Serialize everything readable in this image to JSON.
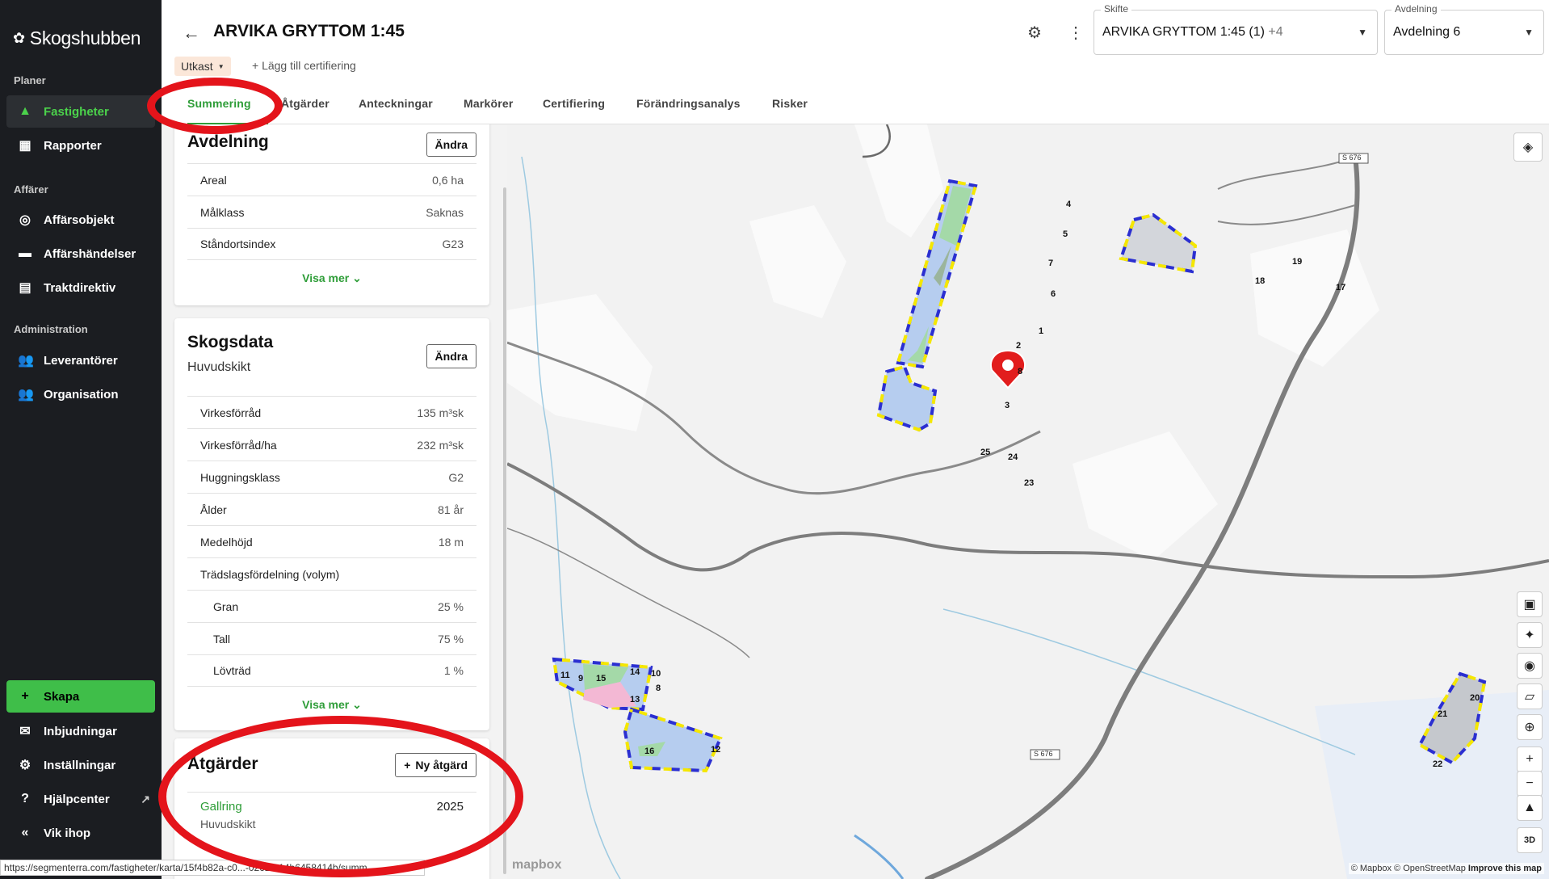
{
  "sidebar": {
    "logo": "Skogshubben",
    "sections": [
      {
        "label": "Planer"
      },
      {
        "label": "Affärer"
      },
      {
        "label": "Administration"
      }
    ],
    "items": [
      {
        "label": "Fastigheter",
        "icon": "tree-icon"
      },
      {
        "label": "Rapporter",
        "icon": "dashboard-icon"
      },
      {
        "label": "Affärsobjekt",
        "icon": "target-icon"
      },
      {
        "label": "Affärshändelser",
        "icon": "briefcase-icon"
      },
      {
        "label": "Traktdirektiv",
        "icon": "clipboard-icon"
      },
      {
        "label": "Leverantörer",
        "icon": "people-icon"
      },
      {
        "label": "Organisation",
        "icon": "people-icon"
      }
    ],
    "bottom": [
      {
        "label": "Skapa",
        "icon": "plus-icon"
      },
      {
        "label": "Inbjudningar",
        "icon": "mail-icon"
      },
      {
        "label": "Inställningar",
        "icon": "gear-icon"
      },
      {
        "label": "Hjälpcenter",
        "icon": "help-icon"
      },
      {
        "label": "Vik ihop",
        "icon": "collapse-icon"
      }
    ]
  },
  "header": {
    "title": "ARVIKA GRYTTOM 1:45",
    "status": "Utkast",
    "add_cert": "Lägg till certifiering",
    "skifte": {
      "label": "Skifte",
      "value": "ARVIKA GRYTTOM 1:45 (1)",
      "extra": "+4"
    },
    "avdelning": {
      "label": "Avdelning",
      "value": "Avdelning 6"
    }
  },
  "tabs": [
    "Summering",
    "Åtgärder",
    "Anteckningar",
    "Markörer",
    "Certifiering",
    "Förändringsanalys",
    "Risker"
  ],
  "avdelning_card": {
    "title": "Avdelning",
    "edit": "Ändra",
    "rows": [
      {
        "k": "Areal",
        "v": "0,6 ha"
      },
      {
        "k": "Målklass",
        "v": "Saknas"
      },
      {
        "k": "Ståndortsindex",
        "v": "G23"
      }
    ],
    "more": "Visa mer"
  },
  "skogsdata_card": {
    "title": "Skogsdata",
    "subtitle": "Huvudskikt",
    "edit": "Ändra",
    "rows": [
      {
        "k": "Virkesförråd",
        "v": "135 m³sk"
      },
      {
        "k": "Virkesförråd/ha",
        "v": "232 m³sk"
      },
      {
        "k": "Huggningsklass",
        "v": "G2"
      },
      {
        "k": "Ålder",
        "v": "81 år"
      },
      {
        "k": "Medelhöjd",
        "v": "18 m"
      },
      {
        "k": "Trädslagsfördelning (volym)",
        "v": ""
      },
      {
        "k": "Gran",
        "v": "25 %"
      },
      {
        "k": "Tall",
        "v": "75 %"
      },
      {
        "k": "Lövträd",
        "v": "1 %"
      }
    ],
    "more": "Visa mer"
  },
  "atgarder_card": {
    "title": "Åtgärder",
    "new_btn": "Ny åtgärd",
    "items": [
      {
        "name": "Gallring",
        "layer": "Huvudskikt",
        "year": "2025"
      }
    ]
  },
  "status_url": "https://segmenterra.com/fastigheter/karta/15f4b82a-c0...-0262-e14b6458414b/summ...",
  "map": {
    "road_labels": [
      "S 676",
      "S 676"
    ],
    "attribution_prefix": "© Mapbox © OpenStreetMap",
    "improve": "Improve this map",
    "logo": "mapbox",
    "parcel_labels": [
      "4",
      "5",
      "7",
      "6",
      "1",
      "2",
      "8",
      "3",
      "25",
      "24",
      "23",
      "19",
      "18",
      "17",
      "11",
      "9",
      "15",
      "14",
      "10",
      "8",
      "13",
      "16",
      "12",
      "21",
      "20",
      "22"
    ],
    "controls": [
      "layers-icon",
      "contact-icon",
      "satellite-icon",
      "camera-icon",
      "ruler-icon",
      "locate-icon",
      "zoom-in-icon",
      "zoom-out-icon",
      "compass-icon",
      "3d-icon"
    ],
    "three_d": "3D"
  },
  "colors": {
    "accent": "#2e9d38",
    "sidebar_bg": "#1b1d21",
    "annotation": "#e4141b"
  }
}
